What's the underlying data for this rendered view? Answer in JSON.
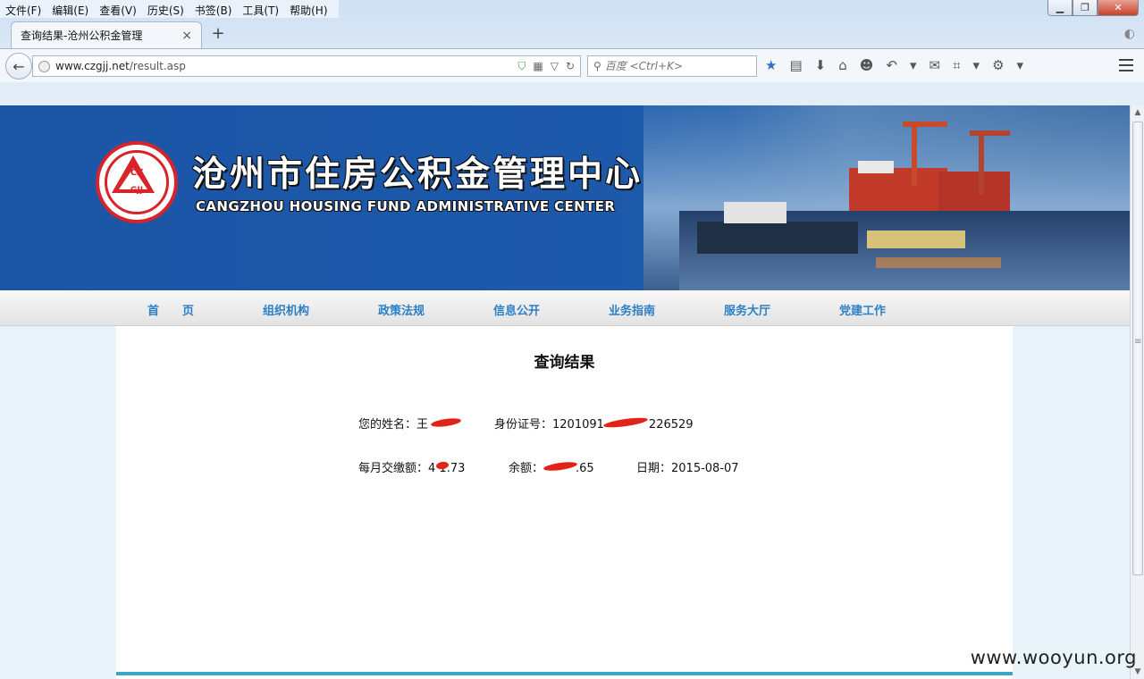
{
  "browser": {
    "menu": [
      "文件(F)",
      "编辑(E)",
      "查看(V)",
      "历史(S)",
      "书签(B)",
      "工具(T)",
      "帮助(H)"
    ],
    "tab_title": "查询结果-沧州公积金管理",
    "tab_close": "×",
    "new_tab": "+",
    "url_host": "www.czgjj.net",
    "url_path": "/result.asp",
    "search_placeholder": "百度 <Ctrl+K>"
  },
  "banner": {
    "title_cn": "沧州市住房公积金管理中心",
    "title_en": "CANGZHOU HOUSING FUND ADMINISTRATIVE CENTER",
    "logo_top": "CZ",
    "logo_bottom": "GJJ"
  },
  "nav": [
    "首　　页",
    "组织机构",
    "政策法规",
    "信息公开",
    "业务指南",
    "服务大厅",
    "党建工作"
  ],
  "result": {
    "title": "查询结果",
    "name_label": "您的姓名：",
    "name_value": "王",
    "id_label": "身份证号：",
    "id_prefix": "1201091",
    "id_suffix": "226529",
    "monthly_label": "每月交缴额：",
    "monthly_value": "4 1.73",
    "balance_label": "余额：",
    "balance_value": ".65",
    "date_label": "日期：",
    "date_value": "2015-08-07"
  },
  "watermark": "www.wooyun.org",
  "colors": {
    "brand_blue": "#1b55a6",
    "nav_text": "#2e80c4",
    "logo_red": "#d9232b",
    "redact": "#e2231a"
  }
}
